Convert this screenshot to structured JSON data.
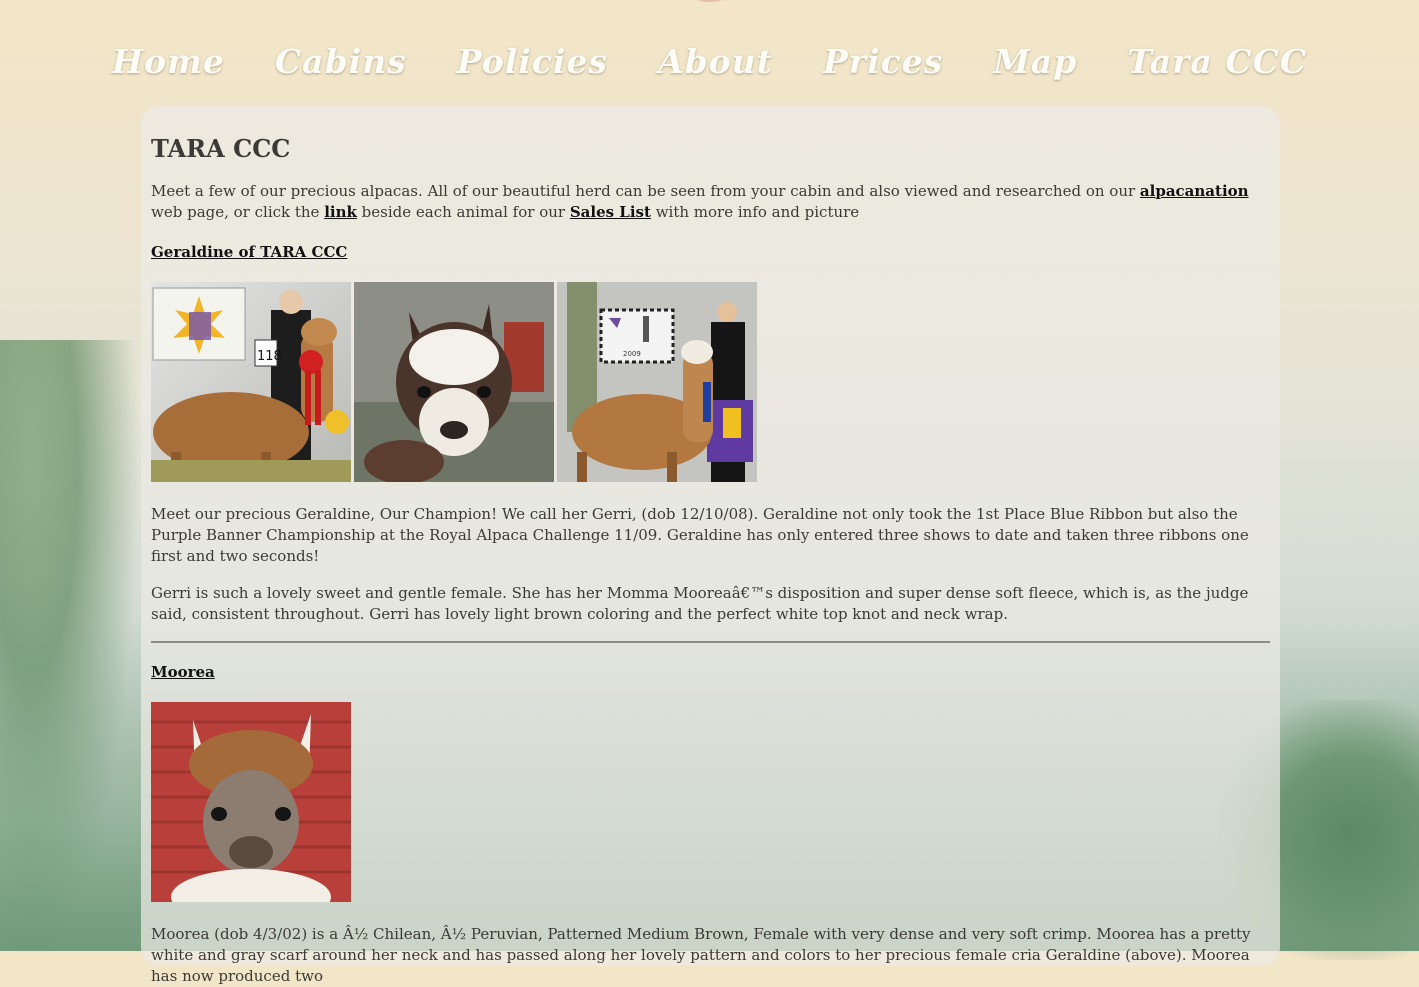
{
  "nav": {
    "items": [
      "Home",
      "Cabins",
      "Policies",
      "About",
      "Prices",
      "Map",
      "Tara CCC"
    ]
  },
  "page": {
    "title": "TARA CCC",
    "intro": {
      "part1": "Meet a few of our precious alpacas. All of our beautiful herd can be seen from your cabin and also viewed and researched on our ",
      "link1": "alpacanation",
      "part2": " web page, or click the ",
      "link2": "link",
      "part3": " beside each animal for our ",
      "link3": "Sales List",
      "part4": " with more info and picture"
    }
  },
  "animals": [
    {
      "name": "Geraldine of TARA CCC",
      "photos": [
        "geraldine-show-photo",
        "geraldine-closeup-photo",
        "geraldine-banner-photo"
      ],
      "photo_text": {
        "show_badge_number": "118",
        "challenge_year": "2009"
      },
      "paragraphs": [
        "Meet our precious Geraldine, Our Champion! We call her Gerri, (dob 12/10/08). Geraldine not only took the 1st Place Blue Ribbon but also the Purple Banner Championship at the Royal Alpaca Challenge 11/09. Geraldine has only entered three shows to date and taken three ribbons one first and two seconds!",
        "Gerri is such a lovely sweet and gentle female. She has her Momma Mooreaâ€™s disposition and super dense soft fleece, which is, as the judge said, consistent throughout. Gerri has lovely light brown coloring and the perfect white top knot and neck wrap."
      ]
    },
    {
      "name": "Moorea",
      "photos": [
        "moorea-portrait-photo"
      ],
      "paragraphs": [
        "Moorea (dob 4/3/02) is a Â½ Chilean, Â½ Peruvian, Patterned Medium Brown, Female with very dense and very soft crimp. Moorea has a pretty white and gray scarf around her neck and has passed along her lovely pattern and colors to her precious female cria Geraldine (above). Moorea has now produced two"
      ]
    }
  ],
  "colors": {
    "nav_text": "#fffdf7",
    "body_text": "#3c3a36",
    "link": "#111111",
    "panel": "#eceae4"
  }
}
